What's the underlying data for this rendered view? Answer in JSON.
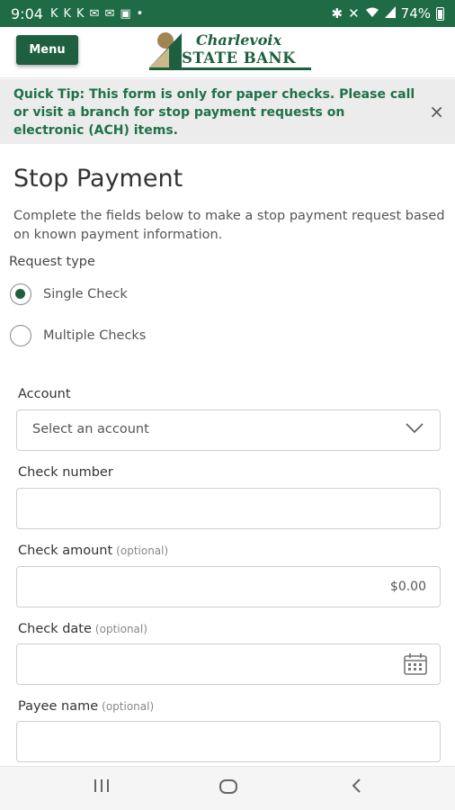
{
  "status_bar": {
    "time": "9:04",
    "notification_icons": [
      "K",
      "K",
      "K",
      "✉",
      "✉",
      "▣",
      "•"
    ],
    "battery": "74%"
  },
  "header": {
    "menu_label": "Menu",
    "logo_line1": "Charlevoix",
    "logo_line2": "STATE BANK",
    "brand_color": "#1e5f3f"
  },
  "tip": {
    "text": "Quick Tip: This form is only for paper checks. Please call or visit a branch for stop payment requests on electronic (ACH) items.",
    "close": "×"
  },
  "form": {
    "title": "Stop Payment",
    "description": "Complete the fields below to make a stop payment request based on known payment information.",
    "request_type_label": "Request type",
    "options": [
      {
        "label": "Single Check",
        "selected": true
      },
      {
        "label": "Multiple Checks",
        "selected": false
      }
    ],
    "account": {
      "label": "Account",
      "value": "Select an account"
    },
    "check_number": {
      "label": "Check number",
      "value": ""
    },
    "check_amount": {
      "label": "Check amount",
      "optional": "(optional)",
      "value": "$0.00"
    },
    "check_date": {
      "label": "Check date",
      "optional": "(optional)",
      "value": ""
    },
    "payee_name": {
      "label": "Payee name",
      "optional": "(optional)",
      "value": ""
    }
  },
  "nav": {
    "recent_icon": "recent-apps-icon",
    "home_icon": "home-icon",
    "back_icon": "back-icon"
  }
}
